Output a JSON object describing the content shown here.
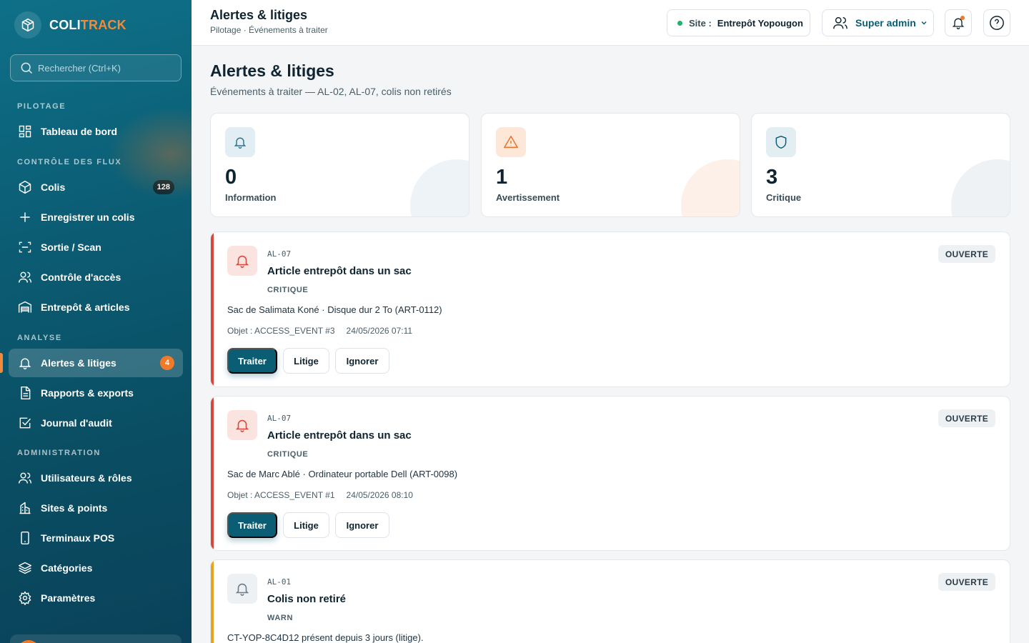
{
  "brand": {
    "part1": "COLI",
    "part2": "TRACK"
  },
  "search": {
    "placeholder": "Rechercher (Ctrl+K)"
  },
  "sidebar": {
    "sections": {
      "pilotage": "PILOTAGE",
      "controle": "CONTRÔLE DES FLUX",
      "analyse": "ANALYSE",
      "administration": "ADMINISTRATION"
    },
    "items": {
      "tableau": "Tableau de bord",
      "colis": "Colis",
      "colis_badge": "128",
      "enregistrer": "Enregistrer un colis",
      "sortie": "Sortie / Scan",
      "controle_acces": "Contrôle d'accès",
      "entrepot": "Entrepôt & articles",
      "alertes": "Alertes & litiges",
      "alertes_badge": "4",
      "rapports": "Rapports & exports",
      "journal": "Journal d'audit",
      "utilisateurs": "Utilisateurs & rôles",
      "sites": "Sites & points",
      "terminaux": "Terminaux POS",
      "categories": "Catégories",
      "parametres": "Paramètres"
    }
  },
  "topbar": {
    "title": "Alertes & litiges",
    "subtitle": "Pilotage · Événements à traiter",
    "site_label": "Site :",
    "site_value": "Entrepôt Yopougon",
    "user": "Super admin"
  },
  "page": {
    "title": "Alertes & litiges",
    "subtitle": "Événements à traiter — AL-02, AL-07, colis non retirés"
  },
  "stats": [
    {
      "value": "0",
      "label": "Information",
      "color": "#2a6f8c"
    },
    {
      "value": "1",
      "label": "Avertissement",
      "color": "#e8762c"
    },
    {
      "value": "3",
      "label": "Critique",
      "color": "#0b5d74"
    }
  ],
  "alerts": [
    {
      "code": "AL-07",
      "title": "Article entrepôt dans un sac",
      "severity": "CRITIQUE",
      "description": "Sac de Salimata Koné · Disque dur 2 To (ART-0112)",
      "object": "Objet : ACCESS_EVENT #3",
      "date": "24/05/2026 07:11",
      "status": "OUVERTE",
      "accent": "#d9473a"
    },
    {
      "code": "AL-07",
      "title": "Article entrepôt dans un sac",
      "severity": "CRITIQUE",
      "description": "Sac de Marc Ablé · Ordinateur portable Dell (ART-0098)",
      "object": "Objet : ACCESS_EVENT #1",
      "date": "24/05/2026 08:10",
      "status": "OUVERTE",
      "accent": "#d9473a"
    },
    {
      "code": "AL-01",
      "title": "Colis non retiré",
      "severity": "WARN",
      "description": "CT-YOP-8C4D12 présent depuis 3 jours (litige).",
      "status": "OUVERTE",
      "accent": "#e8a320"
    }
  ],
  "actions": {
    "treat": "Traiter",
    "dispute": "Litige",
    "ignore": "Ignorer"
  }
}
